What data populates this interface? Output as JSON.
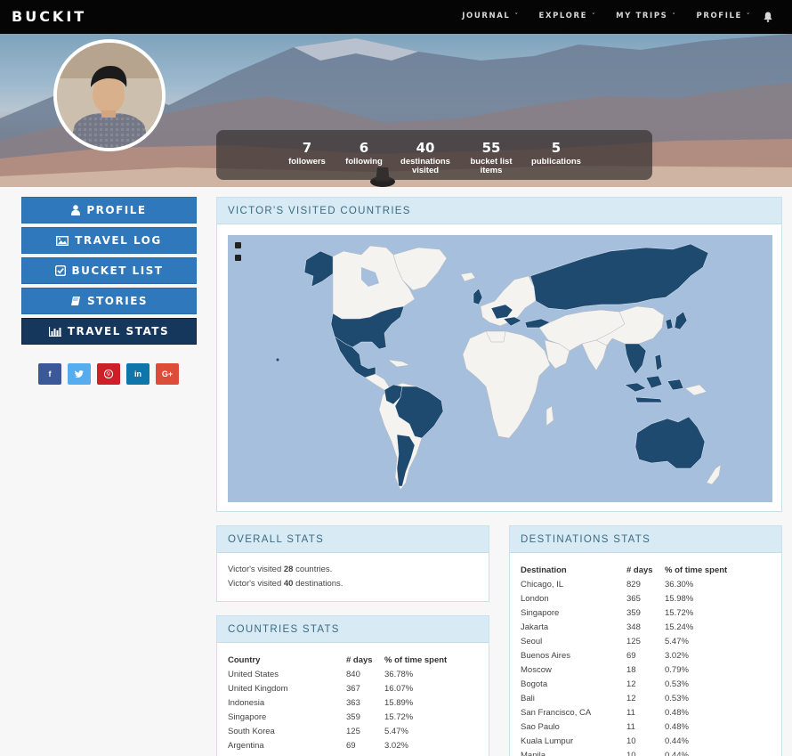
{
  "app": {
    "brand": "BUCKIT"
  },
  "nav": {
    "items": [
      {
        "label": "JOURNAL",
        "caret": "˅"
      },
      {
        "label": "EXPLORE",
        "caret": "˅"
      },
      {
        "label": "MY TRIPS",
        "caret": "˅"
      },
      {
        "label": "PROFILE",
        "caret": "˅"
      }
    ]
  },
  "profile": {
    "stats": [
      {
        "num": "7",
        "label1": "followers",
        "label2": ""
      },
      {
        "num": "6",
        "label1": "following",
        "label2": ""
      },
      {
        "num": "40",
        "label1": "destinations",
        "label2": "visited"
      },
      {
        "num": "55",
        "label1": "bucket list",
        "label2": "items"
      },
      {
        "num": "5",
        "label1": "publications",
        "label2": ""
      }
    ]
  },
  "sidebar": {
    "buttons": [
      {
        "label": "PROFILE",
        "icon": "user-icon"
      },
      {
        "label": "TRAVEL LOG",
        "icon": "image-icon"
      },
      {
        "label": "BUCKET LIST",
        "icon": "checkbox-icon"
      },
      {
        "label": "STORIES",
        "icon": "book-icon"
      },
      {
        "label": "TRAVEL STATS",
        "icon": "bar-chart-icon"
      }
    ],
    "social": [
      {
        "glyph": "f",
        "icon": "facebook-icon",
        "color": "#3b5998"
      },
      {
        "glyph": "t",
        "icon": "twitter-icon",
        "color": "#55acee"
      },
      {
        "glyph": "p",
        "icon": "pinterest-icon",
        "color": "#cb2027"
      },
      {
        "glyph": "in",
        "icon": "linkedin-icon",
        "color": "#0e76a8"
      },
      {
        "glyph": "G+",
        "icon": "google-plus-icon",
        "color": "#dd4b39"
      }
    ]
  },
  "map_panel": {
    "title": "VICTOR'S VISITED COUNTRIES",
    "ocean_color": "#a5bfdd",
    "visited_color": "#1e4a70",
    "unvisited_color": "#f4f3ef"
  },
  "overall": {
    "title": "OVERALL STATS",
    "line1": {
      "pre": "Victor's visited ",
      "num": "28",
      "post": " countries."
    },
    "line2": {
      "pre": "Victor's visited ",
      "num": "40",
      "post": " destinations."
    }
  },
  "countries": {
    "title": "COUNTRIES STATS",
    "headers": [
      "Country",
      "# days",
      "% of time spent"
    ],
    "rows": [
      [
        "United States",
        "840",
        "36.78%"
      ],
      [
        "United Kingdom",
        "367",
        "16.07%"
      ],
      [
        "Indonesia",
        "363",
        "15.89%"
      ],
      [
        "Singapore",
        "359",
        "15.72%"
      ],
      [
        "South Korea",
        "125",
        "5.47%"
      ],
      [
        "Argentina",
        "69",
        "3.02%"
      ]
    ]
  },
  "destinations": {
    "title": "DESTINATIONS STATS",
    "headers": [
      "Destination",
      "# days",
      "% of time spent"
    ],
    "rows": [
      [
        "Chicago, IL",
        "829",
        "36.30%"
      ],
      [
        "London",
        "365",
        "15.98%"
      ],
      [
        "Singapore",
        "359",
        "15.72%"
      ],
      [
        "Jakarta",
        "348",
        "15.24%"
      ],
      [
        "Seoul",
        "125",
        "5.47%"
      ],
      [
        "Buenos Aires",
        "69",
        "3.02%"
      ],
      [
        "Moscow",
        "18",
        "0.79%"
      ],
      [
        "Bogota",
        "12",
        "0.53%"
      ],
      [
        "Bali",
        "12",
        "0.53%"
      ],
      [
        "San Francisco, CA",
        "11",
        "0.48%"
      ],
      [
        "Sao Paulo",
        "11",
        "0.48%"
      ],
      [
        "Kuala Lumpur",
        "10",
        "0.44%"
      ],
      [
        "Manila",
        "10",
        "0.44%"
      ]
    ]
  }
}
